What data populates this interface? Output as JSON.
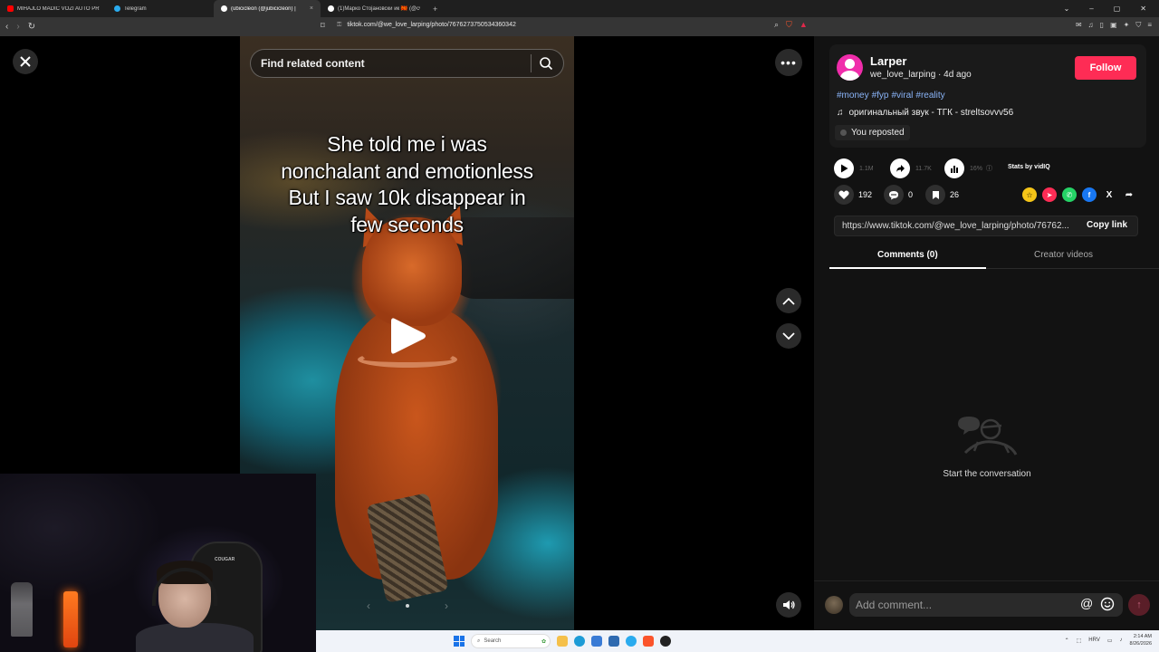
{
  "browser": {
    "tabs": [
      {
        "title": "MIHAJLO MADIĆ VOZI AUTO PRVI P",
        "color": "#ff0000"
      },
      {
        "title": "Telegram",
        "color": "#2aabee"
      },
      {
        "title": "(ubicicleon (@jubicicleon) |",
        "color": "#ffffff"
      },
      {
        "title": "(1)Марко Стојановски ик 🇲🇰 (@cvo",
        "color": "#ffffff"
      }
    ],
    "url": "tiktok.com/@we_love_larping/photo/7676273750534360342"
  },
  "post": {
    "caption_lines": [
      "She told me i was",
      "nonchalant and emotionless",
      "But I saw 10k disappear in",
      "few seconds"
    ],
    "search_placeholder": "Find related content"
  },
  "author": {
    "name": "Larper",
    "subline": "we_love_larping · 4d ago",
    "follow_label": "Follow"
  },
  "hashtags": [
    "#money",
    "#fyp",
    "#viral",
    "#reality"
  ],
  "sound": "оригинальный звук - ТГК - streltsovvv56",
  "repost_label": "You reposted",
  "stats": {
    "plays": "1.1M",
    "shares": "11.7K",
    "percent": "16%",
    "vidiq_label": "Stats by vidIQ"
  },
  "actions": {
    "likes": "192",
    "comments": "0",
    "saves": "26"
  },
  "share_icons": [
    {
      "name": "streak",
      "color": "#f5c518",
      "glyph": "☆"
    },
    {
      "name": "tiktok-send",
      "color": "#fe2c55",
      "glyph": "➤"
    },
    {
      "name": "whatsapp",
      "color": "#25d366",
      "glyph": "✆"
    },
    {
      "name": "facebook",
      "color": "#1877f2",
      "glyph": "f"
    },
    {
      "name": "x",
      "color": "transparent",
      "glyph": "X"
    },
    {
      "name": "share-more",
      "color": "transparent",
      "glyph": "➦"
    }
  ],
  "link": {
    "url": "https://www.tiktok.com/@we_love_larping/photo/76762...",
    "copy_label": "Copy link"
  },
  "tabs": {
    "comments": "Comments (0)",
    "creator_videos": "Creator videos"
  },
  "empty_state": "Start the conversation",
  "comment_input": {
    "placeholder": "Add comment..."
  },
  "webcam": {
    "chair_brand": "COUGAR"
  },
  "taskbar": {
    "search_label": "Search",
    "lang": "HRV",
    "time": "2:14 AM",
    "date": "8/26/2026"
  },
  "colors": {
    "accent": "#fe2c55",
    "hashtag": "#8ab4f8",
    "panel": "#121212"
  }
}
